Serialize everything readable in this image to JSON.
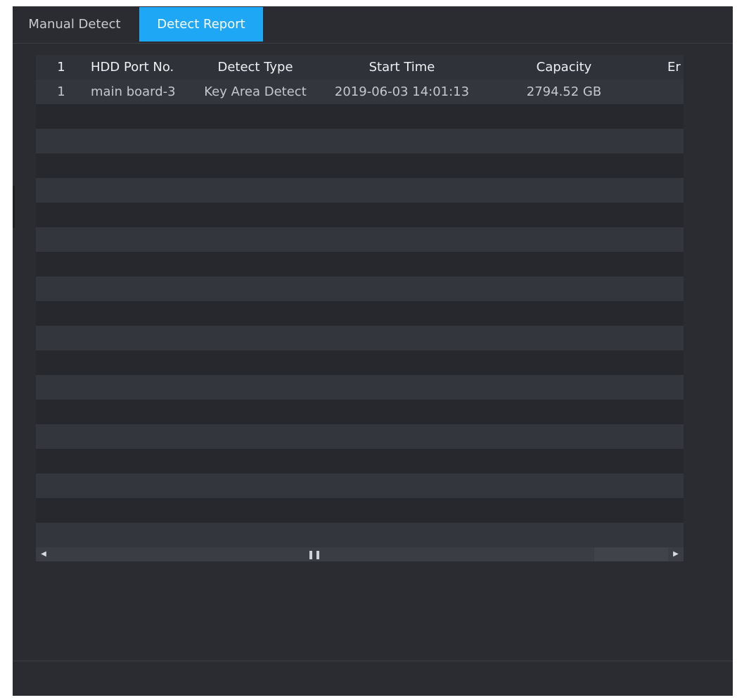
{
  "tabs": [
    {
      "label": "Manual Detect",
      "active": false
    },
    {
      "label": "Detect Report",
      "active": true
    }
  ],
  "table": {
    "columns": [
      "1",
      "HDD Port No.",
      "Detect Type",
      "Start Time",
      "Capacity",
      "Er"
    ],
    "rows": [
      [
        "1",
        "main board-3",
        "Key Area Detect",
        "2019-06-03 14:01:13",
        "2794.52 GB",
        ""
      ]
    ]
  },
  "colors": {
    "panel": "#2a2c32",
    "active_tab": "#1ea7f5",
    "row_odd": "#33363d",
    "row_even": "#26282e"
  }
}
